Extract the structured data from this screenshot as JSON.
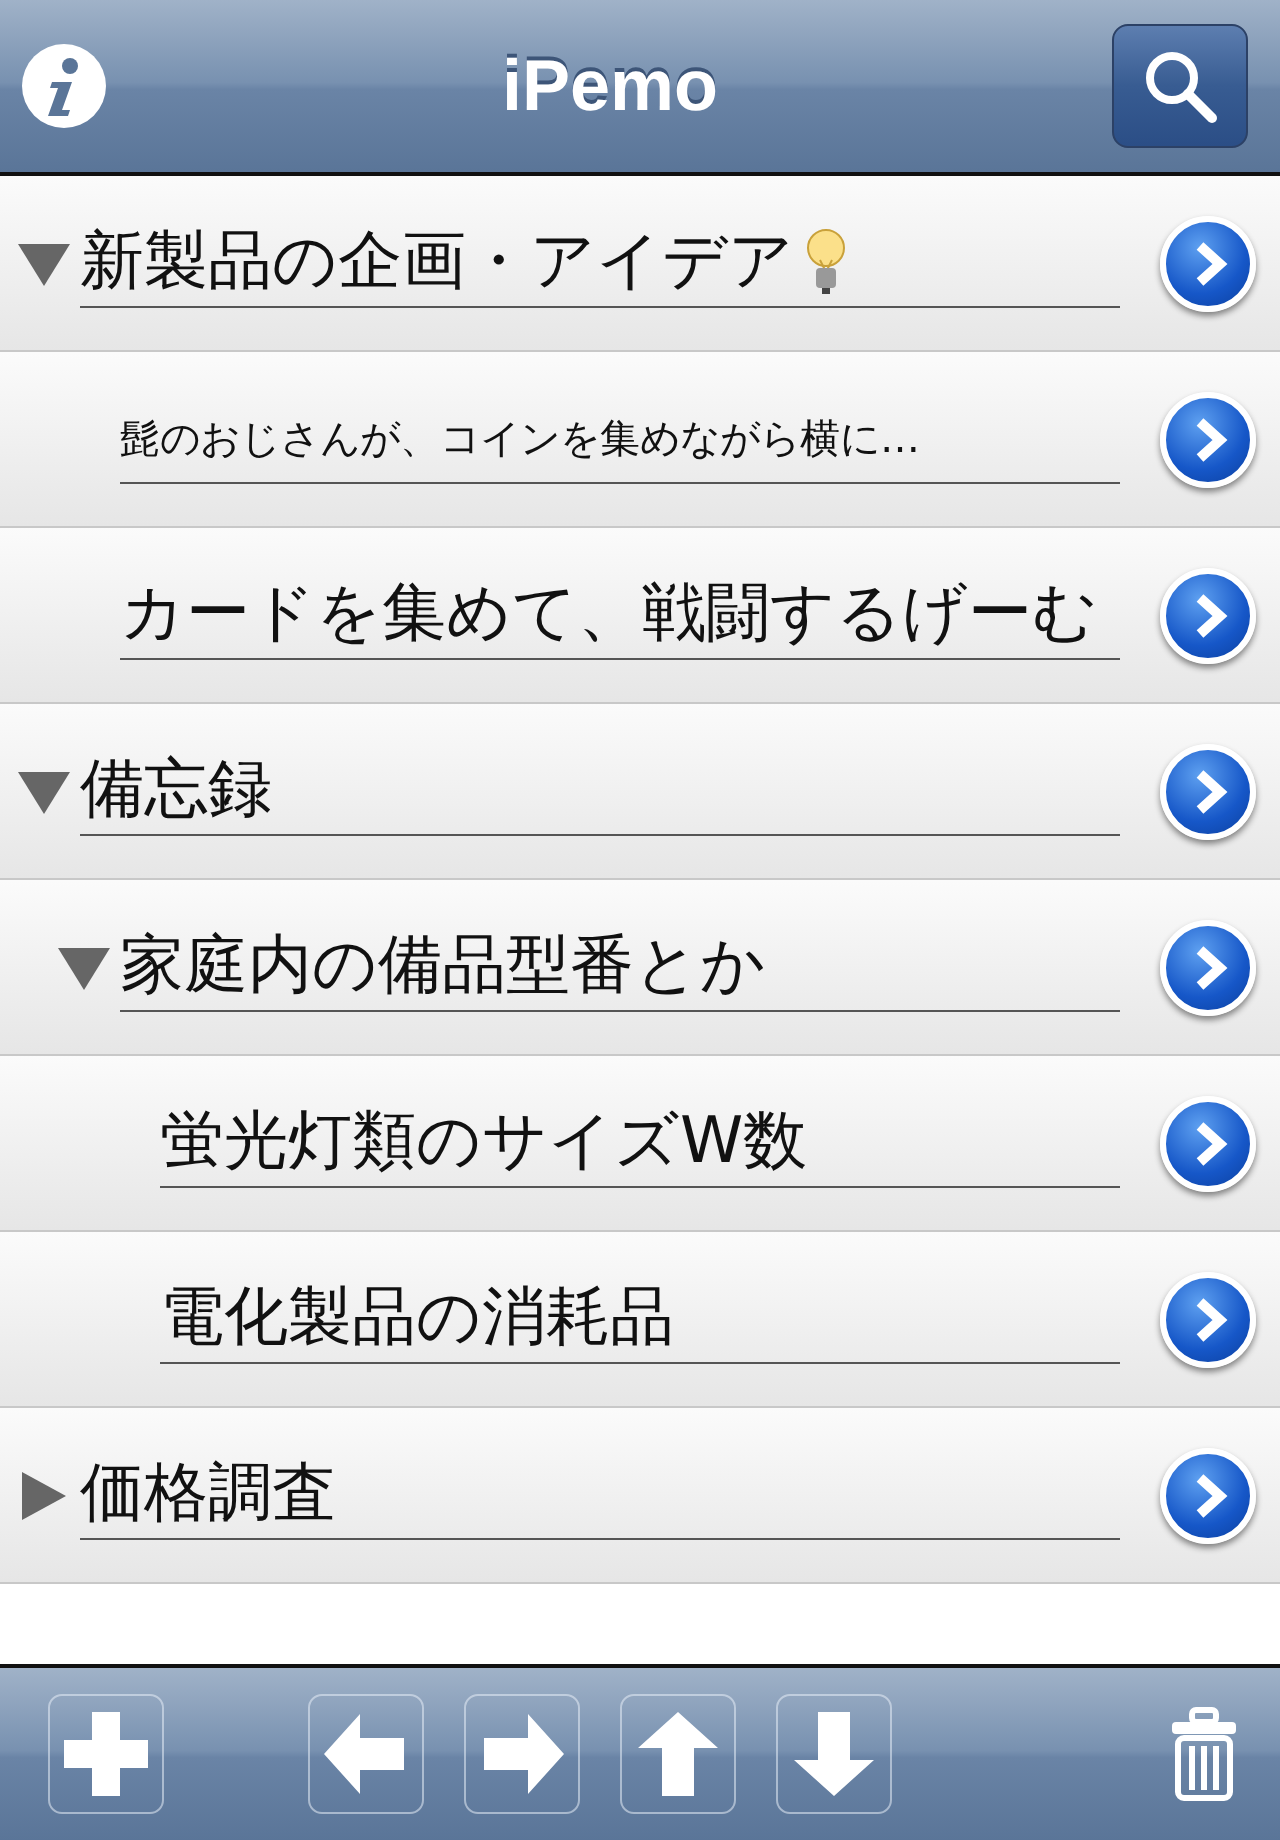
{
  "navbar": {
    "title": "iPemo"
  },
  "tree": [
    {
      "label": "新製品の企画・アイデア",
      "bulb": true,
      "expanded": true,
      "children": [
        {
          "label": "髭のおじさんが、コインを集めながら横に…"
        },
        {
          "label": "カードを集めて、戦闘するげーむ"
        }
      ]
    },
    {
      "label": "備忘録",
      "expanded": true,
      "children": [
        {
          "label": "家庭内の備品型番とか",
          "expanded": true,
          "children": [
            {
              "label": "蛍光灯類のサイズW数"
            },
            {
              "label": "電化製品の消耗品"
            }
          ]
        }
      ]
    },
    {
      "label": "価格調査",
      "expanded": false
    }
  ]
}
